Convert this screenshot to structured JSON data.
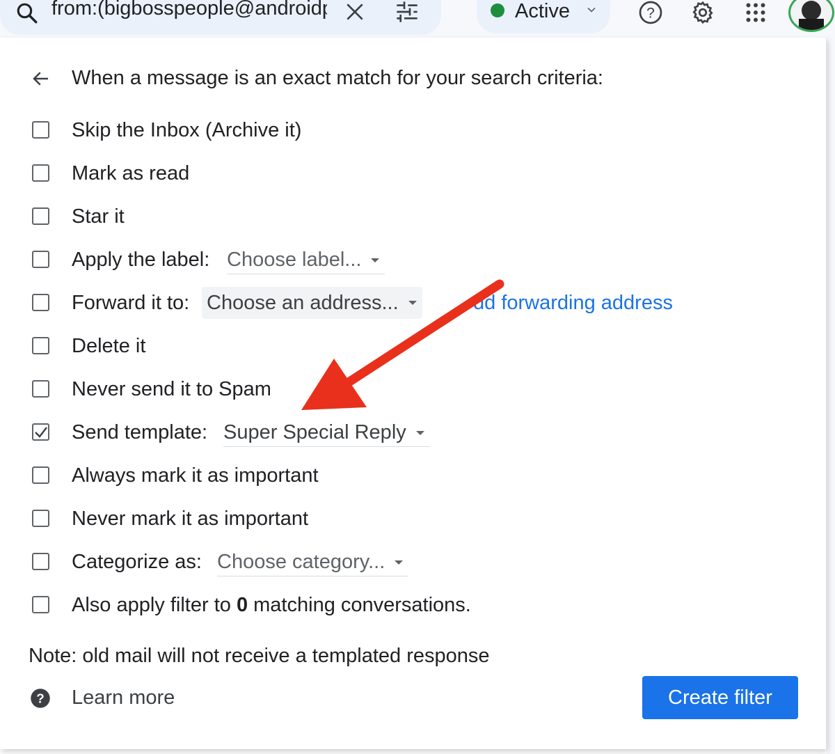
{
  "search": {
    "query": "from:(bigbosspeople@androidp"
  },
  "status": {
    "label": "Active",
    "dot_color": "#1e8e3e"
  },
  "icons": {
    "search": "search-icon",
    "clear": "close-icon",
    "tune": "tune-icon",
    "status_chevron": "chevron-down-icon",
    "help": "help-circle-icon",
    "settings": "gear-icon",
    "apps": "apps-grid-icon",
    "back": "arrow-back-icon",
    "learn_more": "help-filled-icon"
  },
  "filter": {
    "heading": "When a message is an exact match for your search criteria:",
    "options": [
      {
        "label": "Skip the Inbox (Archive it)",
        "checked": false
      },
      {
        "label": "Mark as read",
        "checked": false
      },
      {
        "label": "Star it",
        "checked": false
      },
      {
        "label": "Apply the label:",
        "checked": false,
        "dropdown": "Choose label..."
      },
      {
        "label": "Forward it to:",
        "checked": false,
        "dropdown": "Choose an address...",
        "link": "add forwarding address"
      },
      {
        "label": "Delete it",
        "checked": false
      },
      {
        "label": "Never send it to Spam",
        "checked": false
      },
      {
        "label": "Send template:",
        "checked": true,
        "dropdown": "Super Special Reply"
      },
      {
        "label": "Always mark it as important",
        "checked": false
      },
      {
        "label": "Never mark it as important",
        "checked": false
      },
      {
        "label": "Categorize as:",
        "checked": false,
        "dropdown": "Choose category..."
      },
      {
        "label_prefix": "Also apply filter to ",
        "count": "0",
        "label_suffix": " matching conversations.",
        "checked": false
      }
    ],
    "forward_link_visible": "dd forwarding address",
    "note": "Note: old mail will not receive a templated response",
    "learn_more": "Learn more",
    "create_button": "Create filter"
  },
  "colors": {
    "accent": "#1a73e8",
    "annotation_arrow": "#e8301c"
  }
}
